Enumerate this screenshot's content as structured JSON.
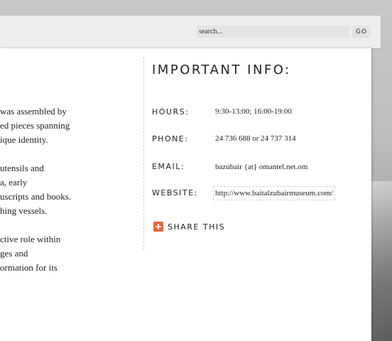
{
  "header": {
    "search_placeholder": "search...",
    "go_label": "GO"
  },
  "left_text": {
    "lines": [
      "was assembled by",
      "ed pieces spanning",
      "ique identity.",
      "utensils and",
      "a, early",
      "uscripts and books.",
      "hing vessels.",
      "ctive role within",
      "ges and",
      "ormation for its"
    ]
  },
  "info": {
    "title": "IMPORTANT INFO:",
    "hours_label": "HOURS:",
    "hours_value": "9:30-13:00; 16:00-19:00",
    "phone_label": "PHONE:",
    "phone_value": "24 736 688 or 24 737 314",
    "email_label": "EMAIL:",
    "email_value": "bazubair {at} omantel.net.om",
    "website_label": "WEBSITE:",
    "website_value": "http://www.baitalzubairmuseum.com/"
  },
  "share": {
    "label": "SHARE THIS",
    "icon": "plus-icon",
    "icon_color": "#e8643c"
  }
}
